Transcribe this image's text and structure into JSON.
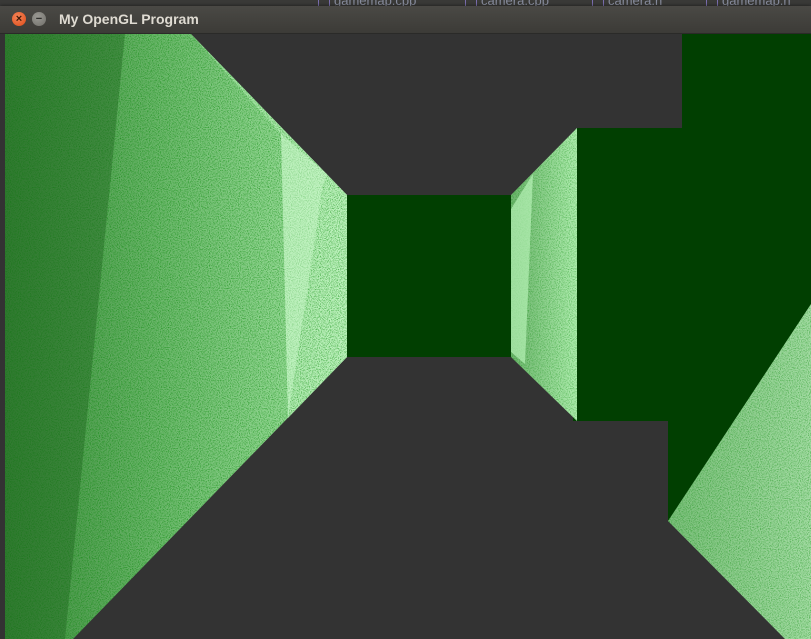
{
  "window": {
    "title": "My OpenGL Program",
    "close_symbol": "×",
    "minimize_symbol": "−"
  },
  "background_tabs": [
    {
      "label": "gamemap.cpp",
      "icon": "file-icon"
    },
    {
      "label": "camera.cpp",
      "icon": "file-icon"
    },
    {
      "label": "camera.h",
      "icon": "file-icon"
    },
    {
      "label": "gamemap.h",
      "icon": "file-icon"
    }
  ],
  "scene": {
    "description_colors": {
      "background": "#333333",
      "wall_dark": "#013a01",
      "wall_mid": "#5fa85f",
      "wall_light": "#b5f0b5"
    }
  }
}
